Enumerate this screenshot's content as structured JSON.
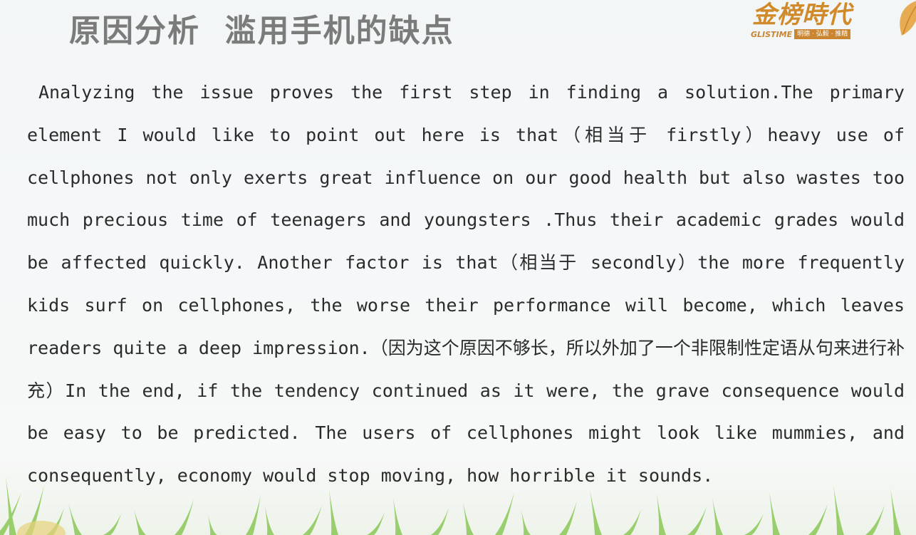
{
  "slide": {
    "title": "原因分析  滥用手机的缺点",
    "logo": {
      "main": "金榜時代",
      "brand": "GLISTIME",
      "tagline": "明德 · 弘毅 · 推精"
    },
    "paragraph": "Analyzing the issue proves the first step in finding a solution.The primary element I would like to point out here is that（相当于 firstly）heavy use of cellphones not only exerts great influence on our good health but also wastes too much precious time of teenagers and youngsters .Thus their academic grades would be affected quickly. Another factor  is that（相当于 secondly）the more frequently kids surf on cellphones, the worse their performance will become, which leaves readers quite a deep impression.（因为这个原因不够长，所以外加了一个非限制性定语从句来进行补充）In the end, if the tendency continued as it were, the grave consequence would be easy to be predicted. The users of cellphones might look like mummies, and consequently, economy would stop moving, how horrible it sounds."
  },
  "colors": {
    "title": "#7b7b7b",
    "text": "#2b2b2b",
    "logo": "#d08a2a",
    "grass": "#7cc242"
  }
}
